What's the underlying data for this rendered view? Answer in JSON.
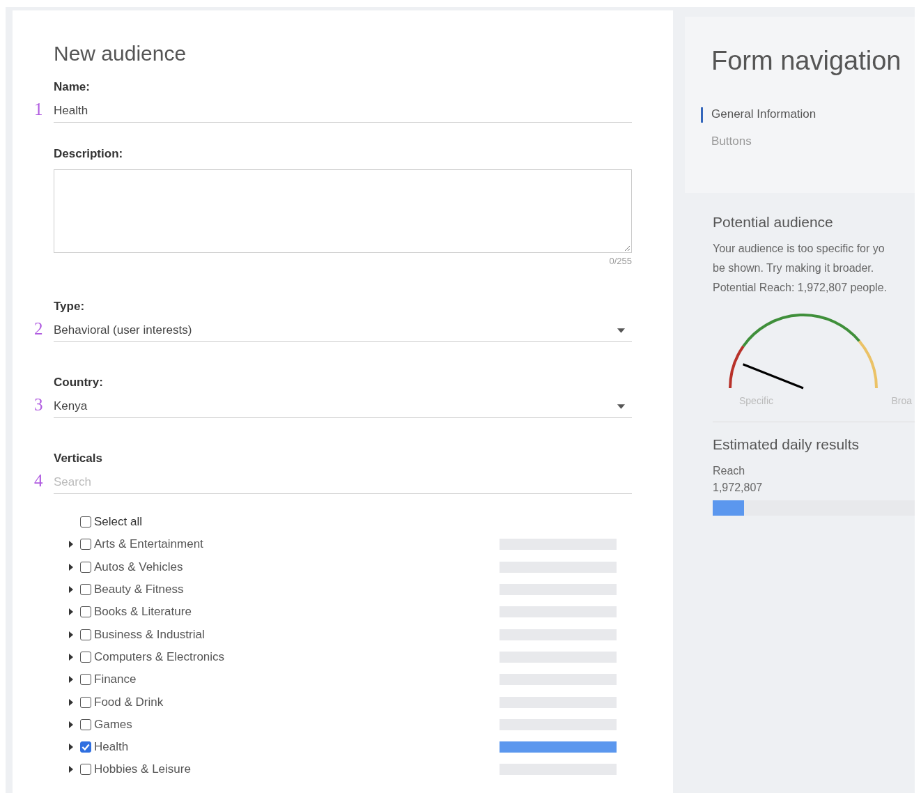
{
  "form": {
    "title": "New audience",
    "fields": [
      {
        "kind": "text",
        "step": "1",
        "label": "Name:",
        "value": "Health"
      },
      {
        "kind": "textarea",
        "label": "Description:",
        "counter": "0/255"
      },
      {
        "kind": "select",
        "step": "2",
        "label": "Type:",
        "value": "Behavioral (user interests)"
      },
      {
        "kind": "select",
        "step": "3",
        "label": "Country:",
        "value": "Kenya"
      },
      {
        "kind": "search",
        "step": "4",
        "label": "Verticals",
        "placeholder": "Search"
      }
    ],
    "select_all": {
      "label": "Select all",
      "checked": false
    },
    "verticals": [
      {
        "label": "Arts & Entertainment",
        "checked": false
      },
      {
        "label": "Autos & Vehicles",
        "checked": false
      },
      {
        "label": "Beauty & Fitness",
        "checked": false
      },
      {
        "label": "Books & Literature",
        "checked": false
      },
      {
        "label": "Business & Industrial",
        "checked": false
      },
      {
        "label": "Computers & Electronics",
        "checked": false
      },
      {
        "label": "Finance",
        "checked": false
      },
      {
        "label": "Food & Drink",
        "checked": false
      },
      {
        "label": "Games",
        "checked": false
      },
      {
        "label": "Health",
        "checked": true
      },
      {
        "label": "Hobbies & Leisure",
        "checked": false
      }
    ]
  },
  "navigation": {
    "title": "Form navigation",
    "items": [
      {
        "label": "General Information",
        "selected": true
      },
      {
        "label": "Buttons",
        "selected": false
      }
    ]
  },
  "potential_audience": {
    "title": "Potential audience",
    "lines": [
      "Your audience is too specific for yo",
      "be shown. Try making it broader."
    ],
    "reach": "Potential Reach: 1,972,807 people.",
    "gauge": {
      "level": 0.12,
      "min_label": "Specific",
      "max_label": "Broa"
    }
  },
  "daily_results": {
    "title": "Estimated daily results",
    "metric": "Reach",
    "value": "1,972,807",
    "level": 0.15
  }
}
